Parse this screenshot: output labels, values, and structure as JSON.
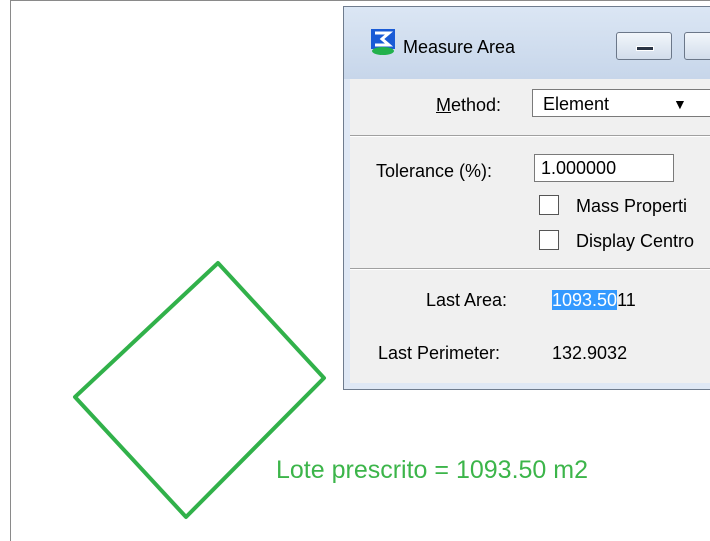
{
  "canvas": {
    "label": "Lote prescrito = 1093.50 m2",
    "shape_color": "#31b14a",
    "label_color": "#3cb54a"
  },
  "dialog": {
    "title": "Measure Area",
    "title_icon": "measure-area-icon",
    "minimize_icon": "minimize-icon",
    "method": {
      "label": "Method:",
      "value": "Element"
    },
    "tolerance": {
      "label": "Tolerance (%):",
      "value": "1.000000"
    },
    "checkboxes": [
      {
        "label": "Mass Properti",
        "checked": false
      },
      {
        "label": "Display Centro",
        "checked": false
      }
    ],
    "results": {
      "area_label": "Last Area:",
      "area_value_selected": "1093.50",
      "area_value_rest": "11",
      "perimeter_label": "Last Perimeter:",
      "perimeter_value": "132.9032"
    }
  }
}
